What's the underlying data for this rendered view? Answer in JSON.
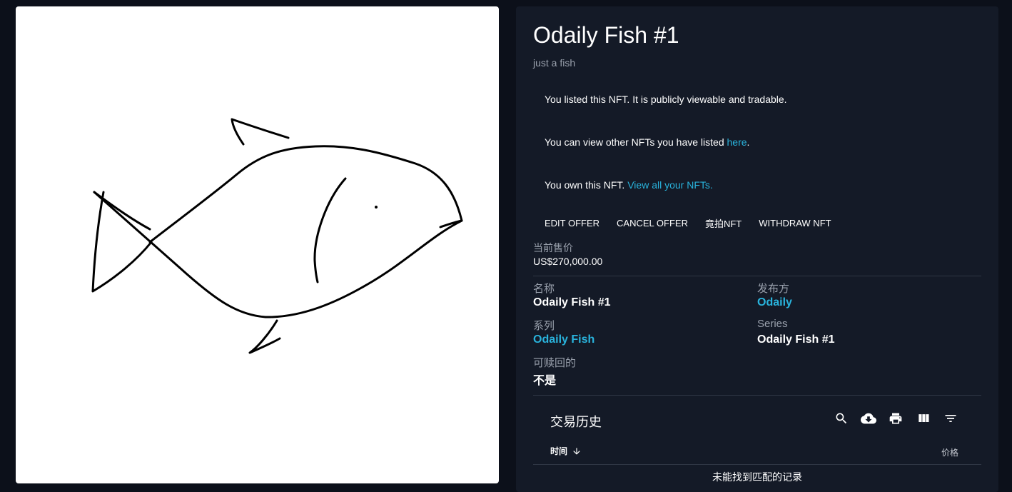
{
  "nft": {
    "title": "Odaily Fish #1",
    "description": "just a fish"
  },
  "notices": {
    "listed": "You listed this NFT. It is publicly viewable and tradable.",
    "view_other_prefix": "You can view other NFTs you have listed ",
    "view_other_link": "here",
    "view_other_suffix": ".",
    "own_prefix": "You own this NFT. ",
    "own_link": "View all your NFTs."
  },
  "actions": {
    "edit_offer": "EDIT OFFER",
    "cancel_offer": "CANCEL OFFER",
    "auction": "竟拍NFT",
    "withdraw": "WITHDRAW NFT"
  },
  "price": {
    "label": "当前售价",
    "value": "US$270,000.00"
  },
  "properties": {
    "name_label": "名称",
    "name_value": "Odaily Fish #1",
    "publisher_label": "发布方",
    "publisher_value": "Odaily",
    "series_cn_label": "系列",
    "series_cn_value": "Odaily Fish",
    "series_label": "Series",
    "series_value": "Odaily Fish #1",
    "redeemable_label": "可赎回的",
    "redeemable_value": "不是"
  },
  "history": {
    "title": "交易历史",
    "col_time": "时间",
    "col_price": "价格",
    "empty": "未能找到匹配的记录",
    "toolbar_icons": [
      "search-icon",
      "cloud-download-icon",
      "print-icon",
      "view-column-icon",
      "filter-list-icon"
    ]
  },
  "colors": {
    "background": "#0c101a",
    "panel": "#141a27",
    "accent": "#29b3dc",
    "muted_text": "#9aa1ad"
  }
}
